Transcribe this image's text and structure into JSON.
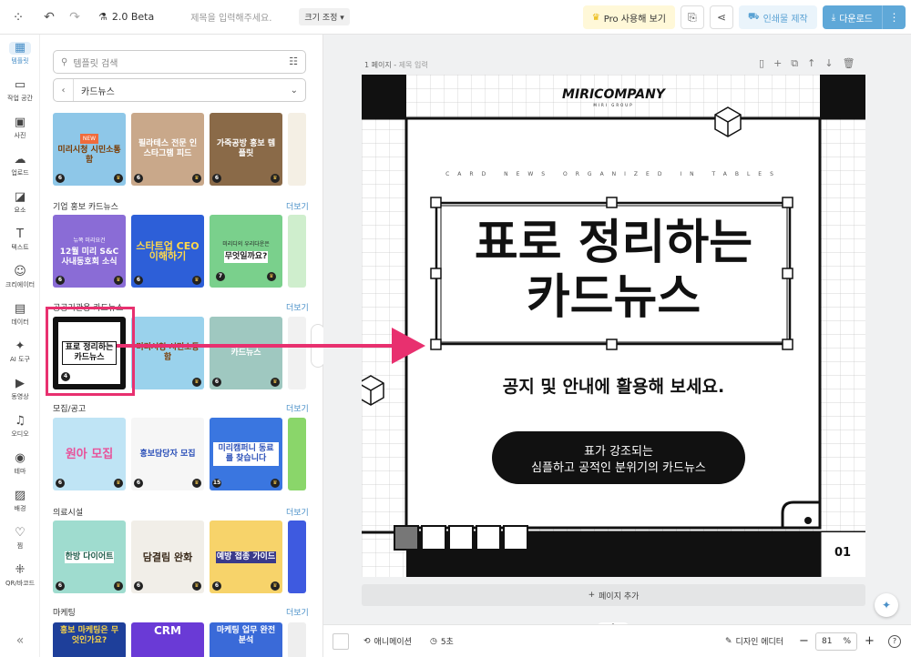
{
  "topbar": {
    "version": "2.0 Beta",
    "title_placeholder": "제목을 입력해주세요.",
    "size_label": "크기 조정",
    "pro_label": "Pro 사용해 보기",
    "print_label": "인쇄물 제작",
    "download_label": "다운로드"
  },
  "sidenav": {
    "items": [
      {
        "label": "템플릿",
        "icon": "template-icon"
      },
      {
        "label": "작업 공간",
        "icon": "folder-icon"
      },
      {
        "label": "사진",
        "icon": "photo-icon"
      },
      {
        "label": "업로드",
        "icon": "upload-icon"
      },
      {
        "label": "요소",
        "icon": "elements-icon"
      },
      {
        "label": "텍스트",
        "icon": "text-icon"
      },
      {
        "label": "크리에이터",
        "icon": "creator-icon"
      },
      {
        "label": "데이터",
        "icon": "data-icon"
      },
      {
        "label": "AI 도구",
        "icon": "ai-tools-icon"
      },
      {
        "label": "동영상",
        "icon": "video-icon"
      },
      {
        "label": "오디오",
        "icon": "audio-icon"
      },
      {
        "label": "테마",
        "icon": "theme-icon"
      },
      {
        "label": "배경",
        "icon": "background-icon"
      },
      {
        "label": "찜",
        "icon": "heart-icon"
      },
      {
        "label": "QR/바코드",
        "icon": "qr-icon"
      }
    ]
  },
  "panel": {
    "search_placeholder": "템플릿 검색",
    "category": "카드뉴스",
    "more_label": "더보기",
    "sections": [
      {
        "title": "기업 홍보 카드뉴스"
      },
      {
        "title": "공공기관용 카드뉴스"
      },
      {
        "title": "모집/공고"
      },
      {
        "title": "의료시설"
      },
      {
        "title": "마케팅"
      }
    ],
    "thumbs": {
      "r0": [
        {
          "text": "미리시청 시민소통함",
          "num": "6"
        },
        {
          "text": "필라테스 전문 인스타그램 피드",
          "num": "6"
        },
        {
          "text": "가죽공방 홍보 템플릿",
          "num": "6"
        }
      ],
      "r1": [
        {
          "tag": "뉴쪽 미리요건",
          "text": "12월 미리 S&C 사내동호회 소식",
          "num": "6"
        },
        {
          "tag": "",
          "text": "스타트업 CEO 이해하기",
          "num": "6"
        },
        {
          "tag": "미리디의 우리다운은",
          "text": "무엇일까요?",
          "num": "7"
        }
      ],
      "r2": [
        {
          "tag": "",
          "text": "표로 정리하는 카드뉴스",
          "num": "4"
        },
        {
          "tag": "",
          "text": "미리시청 시민소통함",
          "num": ""
        },
        {
          "tag": "",
          "text": "카드뉴스",
          "num": "6"
        }
      ],
      "r3": [
        {
          "tag": "",
          "text": "원아 모집",
          "num": "6"
        },
        {
          "tag": "",
          "text": "홍보담당자 모집",
          "num": "6"
        },
        {
          "tag": "",
          "text": "미리캠퍼니 동료를 찾습니다",
          "num": "15"
        }
      ],
      "r4": [
        {
          "tag": "",
          "text": "한방 다이어트",
          "num": "6"
        },
        {
          "tag": "",
          "text": "담결림 완화",
          "num": "6"
        },
        {
          "tag": "",
          "text": "예방 접종 가이드",
          "num": "6"
        }
      ],
      "r5": [
        {
          "tag": "",
          "text": "홍보 마케팅은 무엇인가요?",
          "num": ""
        },
        {
          "tag": "",
          "text": "CRM",
          "num": ""
        },
        {
          "tag": "",
          "text": "마케팅 업무 완전분석",
          "num": ""
        }
      ]
    }
  },
  "workspace": {
    "page_label": "1 페이지",
    "page_title_placeholder": "제목 입력",
    "add_page": "페이지 추가"
  },
  "card": {
    "brand": "MIRICOMPANY",
    "brand_sub": "MIRI GROUP",
    "tagline": "CARD NEWS ORGANIZED IN TABLES",
    "headline_1": "표로 정리하는",
    "headline_2": "카드뉴스",
    "subhead": "공지 및 안내에 활용해 보세요.",
    "pill_1": "표가 강조되는",
    "pill_2": "심플하고 공적인 분위기의 카드뉴스",
    "page_num": "01"
  },
  "bottombar": {
    "animation": "애니메이션",
    "duration": "5초",
    "design_editor": "디자인 에디터",
    "zoom": "81",
    "zoom_unit": "%"
  },
  "colors": {
    "accent": "#5fa8d8",
    "highlight": "#e8306f"
  }
}
